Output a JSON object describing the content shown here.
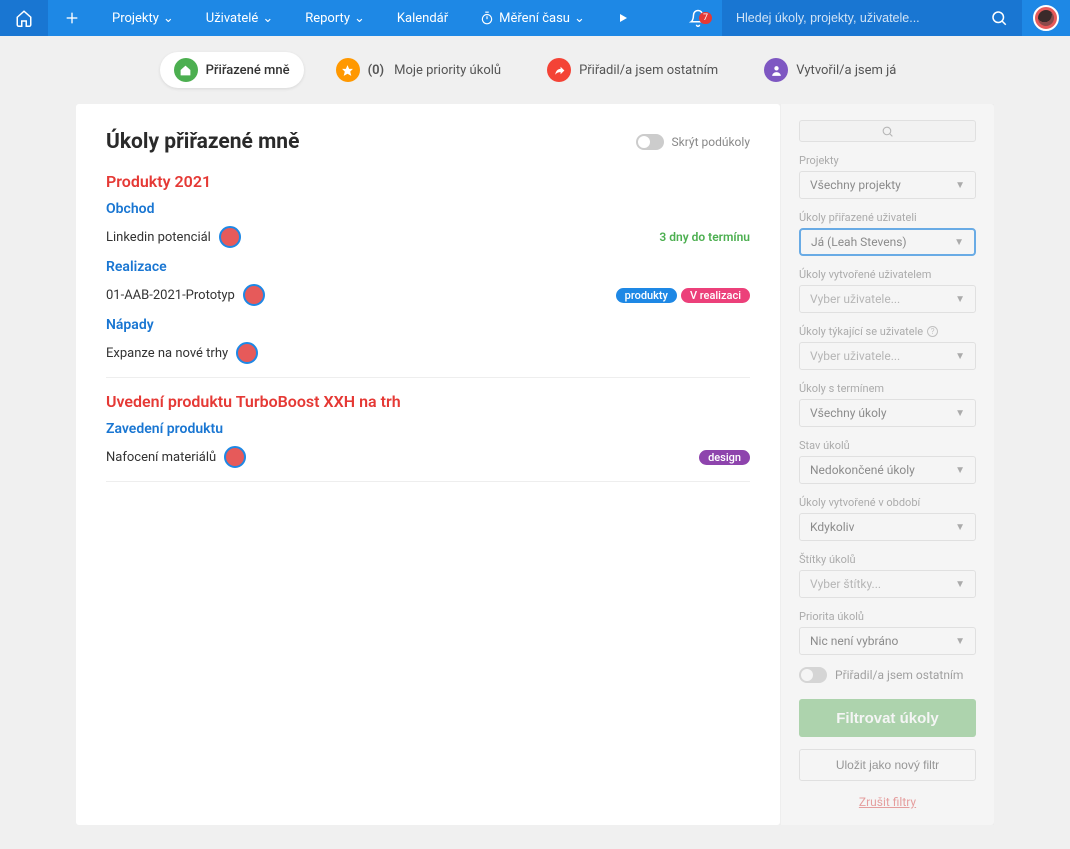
{
  "nav": {
    "items": [
      "Projekty",
      "Uživatelé",
      "Reporty",
      "Kalendář",
      "Měření času"
    ],
    "notification_count": "7",
    "search_placeholder": "Hledej úkoly, projekty, uživatele..."
  },
  "tabs": {
    "t0": "Přiřazené mně",
    "t1_count": "(0)",
    "t1": "Moje priority úkolů",
    "t2": "Přiřadil/a jsem ostatním",
    "t3": "Vytvořil/a jsem já"
  },
  "main": {
    "title": "Úkoly přiřazené mně",
    "hide_subtasks": "Skrýt podúkoly",
    "projects": [
      {
        "name": "Produkty 2021",
        "sections": [
          {
            "title": "Obchod",
            "task": "Linkedin potenciál",
            "due": "3 dny do termínu"
          },
          {
            "title": "Realizace",
            "task": "01-AAB-2021-Prototyp",
            "tags": [
              "produkty",
              "V realizaci"
            ]
          },
          {
            "title": "Nápady",
            "task": "Expanze na nové trhy"
          }
        ]
      },
      {
        "name": "Uvedení produktu TurboBoost XXH na trh",
        "sections": [
          {
            "title": "Zavedení produktu",
            "task": "Nafocení materiálů",
            "tags": [
              "design"
            ]
          }
        ]
      }
    ]
  },
  "sidebar": {
    "labels": {
      "projects": "Projekty",
      "assigned_to": "Úkoly přiřazené uživateli",
      "created_by": "Úkoly vytvořené uživatelem",
      "related_to": "Úkoly týkající se uživatele",
      "with_deadline": "Úkoly s termínem",
      "status": "Stav úkolů",
      "created_period": "Úkoly vytvořené v období",
      "tags": "Štítky úkolů",
      "priority": "Priorita úkolů",
      "assigned_others_toggle": "Přiřadil/a jsem ostatním"
    },
    "values": {
      "projects": "Všechny projekty",
      "assigned_to": "Já (Leah Stevens)",
      "created_by": "Vyber uživatele...",
      "related_to": "Vyber uživatele...",
      "with_deadline": "Všechny úkoly",
      "status": "Nedokončené úkoly",
      "created_period": "Kdykoliv",
      "tags": "Vyber štítky...",
      "priority": "Nic není vybráno"
    },
    "buttons": {
      "filter": "Filtrovat úkoly",
      "save": "Uložit jako nový filtr",
      "cancel": "Zrušit filtry"
    }
  }
}
